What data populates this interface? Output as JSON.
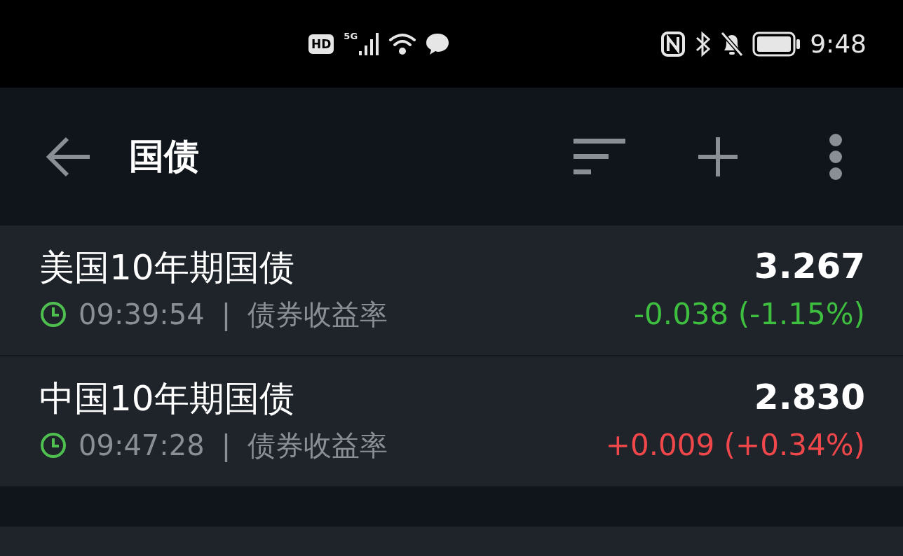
{
  "status_bar": {
    "hd_badge": "HD",
    "network": "5G",
    "time": "9:48"
  },
  "header": {
    "title": "国债"
  },
  "rows": [
    {
      "name": "美国10年期国债",
      "time": "09:39:54",
      "separator": "|",
      "type": "债券收益率",
      "value": "3.267",
      "change": "-0.038 (-1.15%)",
      "kind": "down"
    },
    {
      "name": "中国10年期国债",
      "time": "09:47:28",
      "separator": "|",
      "type": "债券收益率",
      "value": "2.830",
      "change": "+0.009 (+0.34%)",
      "kind": "up"
    }
  ]
}
